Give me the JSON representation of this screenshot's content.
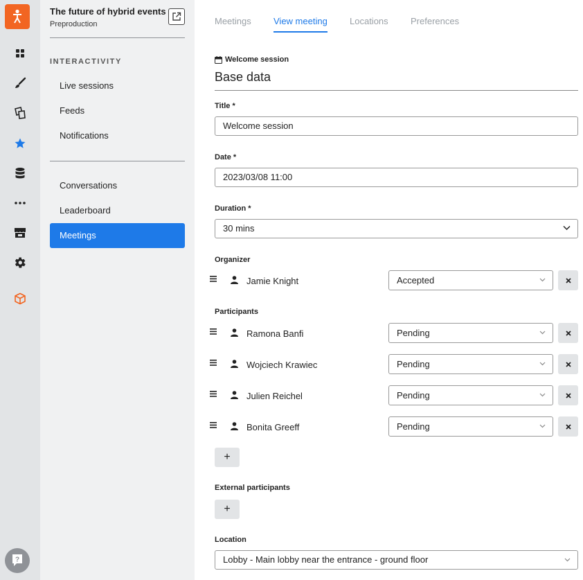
{
  "project": {
    "title": "The future of hybrid events",
    "subtitle": "Preproduction"
  },
  "rail": {
    "icons": [
      "person-logo-icon",
      "grid-icon",
      "brush-icon",
      "pages-icon",
      "star-icon",
      "database-icon",
      "more-icon",
      "store-icon",
      "gear-icon",
      "cube-icon",
      "help-icon"
    ],
    "active": "star-icon",
    "accent": "#1e7ae8",
    "brand": "#f26522"
  },
  "sidebar": {
    "section_title": "INTERACTIVITY",
    "group1": [
      {
        "label": "Live sessions"
      },
      {
        "label": "Feeds"
      },
      {
        "label": "Notifications"
      }
    ],
    "group2": [
      {
        "label": "Conversations"
      },
      {
        "label": "Leaderboard"
      },
      {
        "label": "Meetings"
      }
    ],
    "active": "Meetings"
  },
  "tabs": [
    {
      "label": "Meetings"
    },
    {
      "label": "View meeting"
    },
    {
      "label": "Locations"
    },
    {
      "label": "Preferences"
    }
  ],
  "active_tab": "View meeting",
  "breadcrumb": "Welcome session",
  "heading": "Base data",
  "form": {
    "title_label": "Title *",
    "title_value": "Welcome session",
    "date_label": "Date *",
    "date_value": "2023/03/08 11:00",
    "duration_label": "Duration *",
    "duration_value": "30 mins",
    "organizer_label": "Organizer",
    "organizer": {
      "name": "Jamie Knight",
      "status": "Accepted"
    },
    "participants_label": "Participants",
    "participants": [
      {
        "name": "Ramona Banfi",
        "status": "Pending"
      },
      {
        "name": "Wojciech Krawiec",
        "status": "Pending"
      },
      {
        "name": "Julien Reichel",
        "status": "Pending"
      },
      {
        "name": "Bonita Greeff",
        "status": "Pending"
      }
    ],
    "add_label": "+",
    "external_label": "External participants",
    "location_label": "Location",
    "location_value": "Lobby - Main lobby near the entrance - ground floor"
  }
}
